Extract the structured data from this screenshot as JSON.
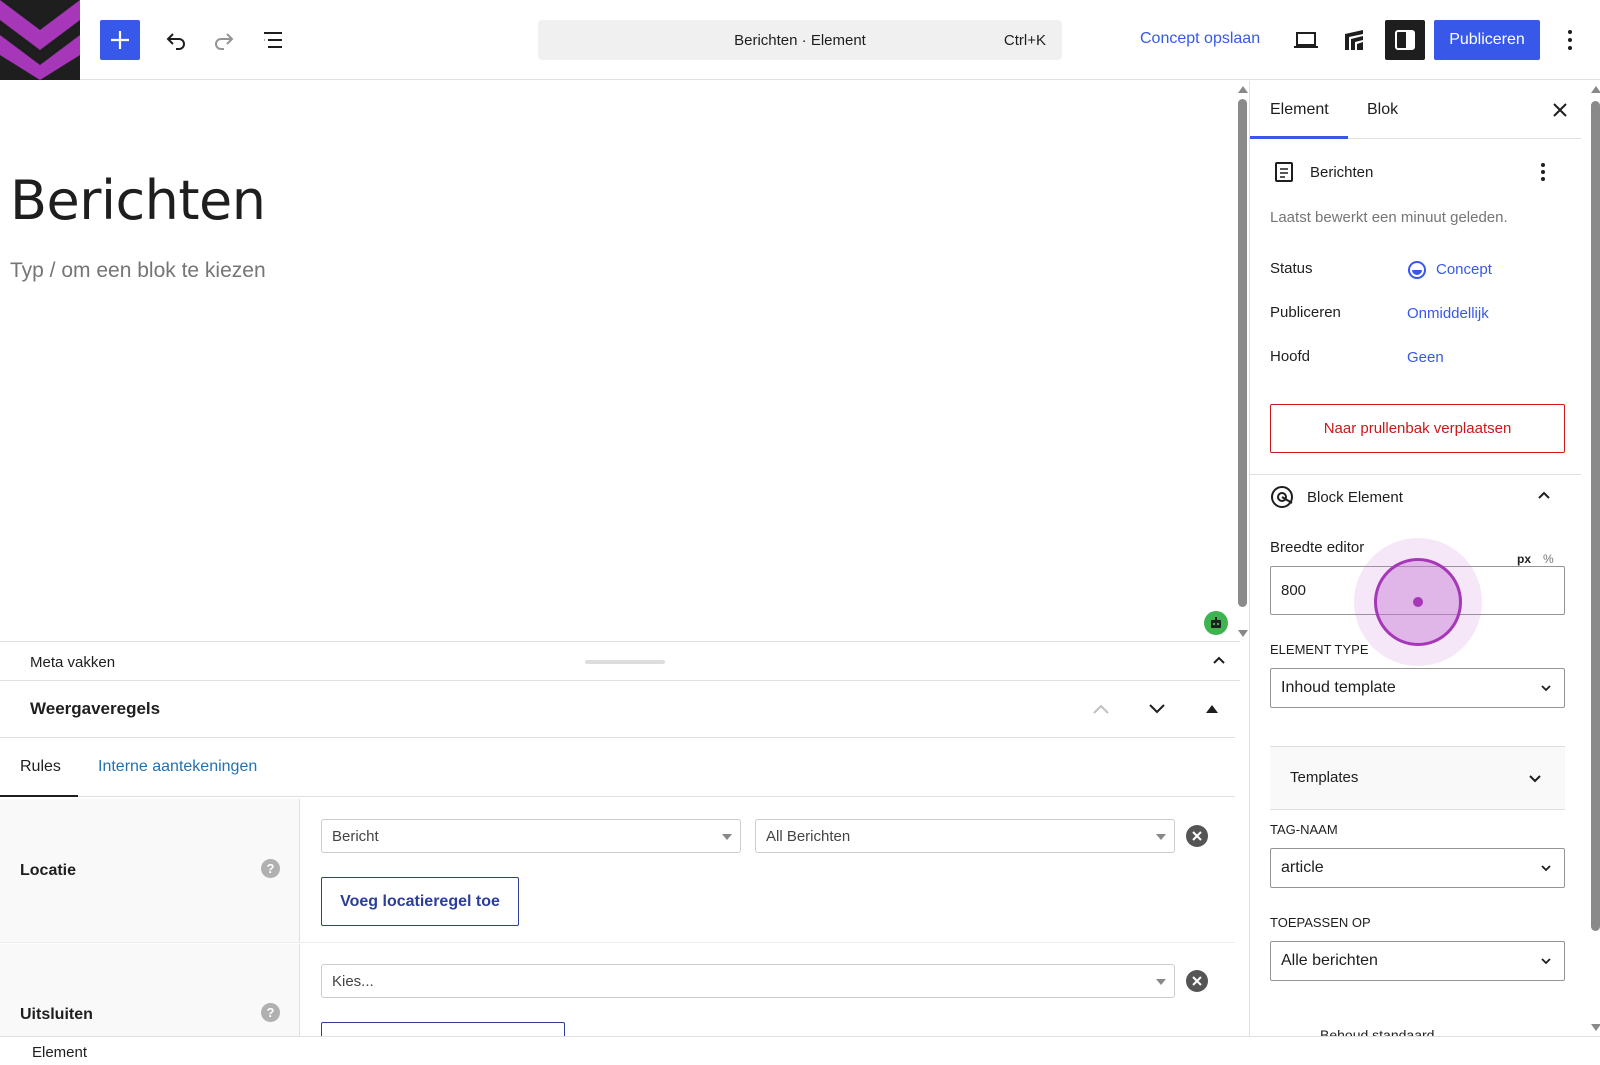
{
  "header": {
    "command_bar": "Berichten · Element",
    "shortcut": "Ctrl+K",
    "draft_label": "Concept opslaan",
    "publish_label": "Publiceren"
  },
  "editor": {
    "title": "Berichten",
    "placeholder": "Typ / om een blok te kiezen"
  },
  "meta": {
    "label": "Meta vakken"
  },
  "rules": {
    "title": "Weergaveregels",
    "tabs": [
      "Rules",
      "Interne aantekeningen"
    ],
    "location": {
      "label": "Locatie",
      "select1": "Bericht",
      "select2": "All Berichten",
      "add_button": "Voeg locatieregel toe"
    },
    "exclude": {
      "label": "Uitsluiten",
      "select": "Kies..."
    },
    "help_glyph": "?"
  },
  "status_bar": {
    "label": "Element"
  },
  "sidebar": {
    "tabs": [
      "Element",
      "Blok"
    ],
    "doc_title": "Berichten",
    "last_edited": "Laatst bewerkt een minuut geleden.",
    "status_label": "Status",
    "status_value": "Concept",
    "publish_label": "Publiceren",
    "publish_value": "Onmiddellijk",
    "parent_label": "Hoofd",
    "parent_value": "Geen",
    "trash_button": "Naar prullenbak verplaatsen",
    "block_element_title": "Block Element",
    "width_label": "Breedte editor",
    "unit_px": "px",
    "unit_pct": "%",
    "width_value": "800",
    "element_type_label": "Element type",
    "element_type_value": "Inhoud template",
    "templates_label": "Templates",
    "tag_label": "Tag-naam",
    "tag_value": "article",
    "apply_label": "Toepassen op",
    "apply_value": "Alle berichten",
    "cut_off_text": "Behoud standaard"
  },
  "colors": {
    "accent": "#3858e9",
    "danger": "#cc1818",
    "logo_purple": "#a637b8"
  }
}
